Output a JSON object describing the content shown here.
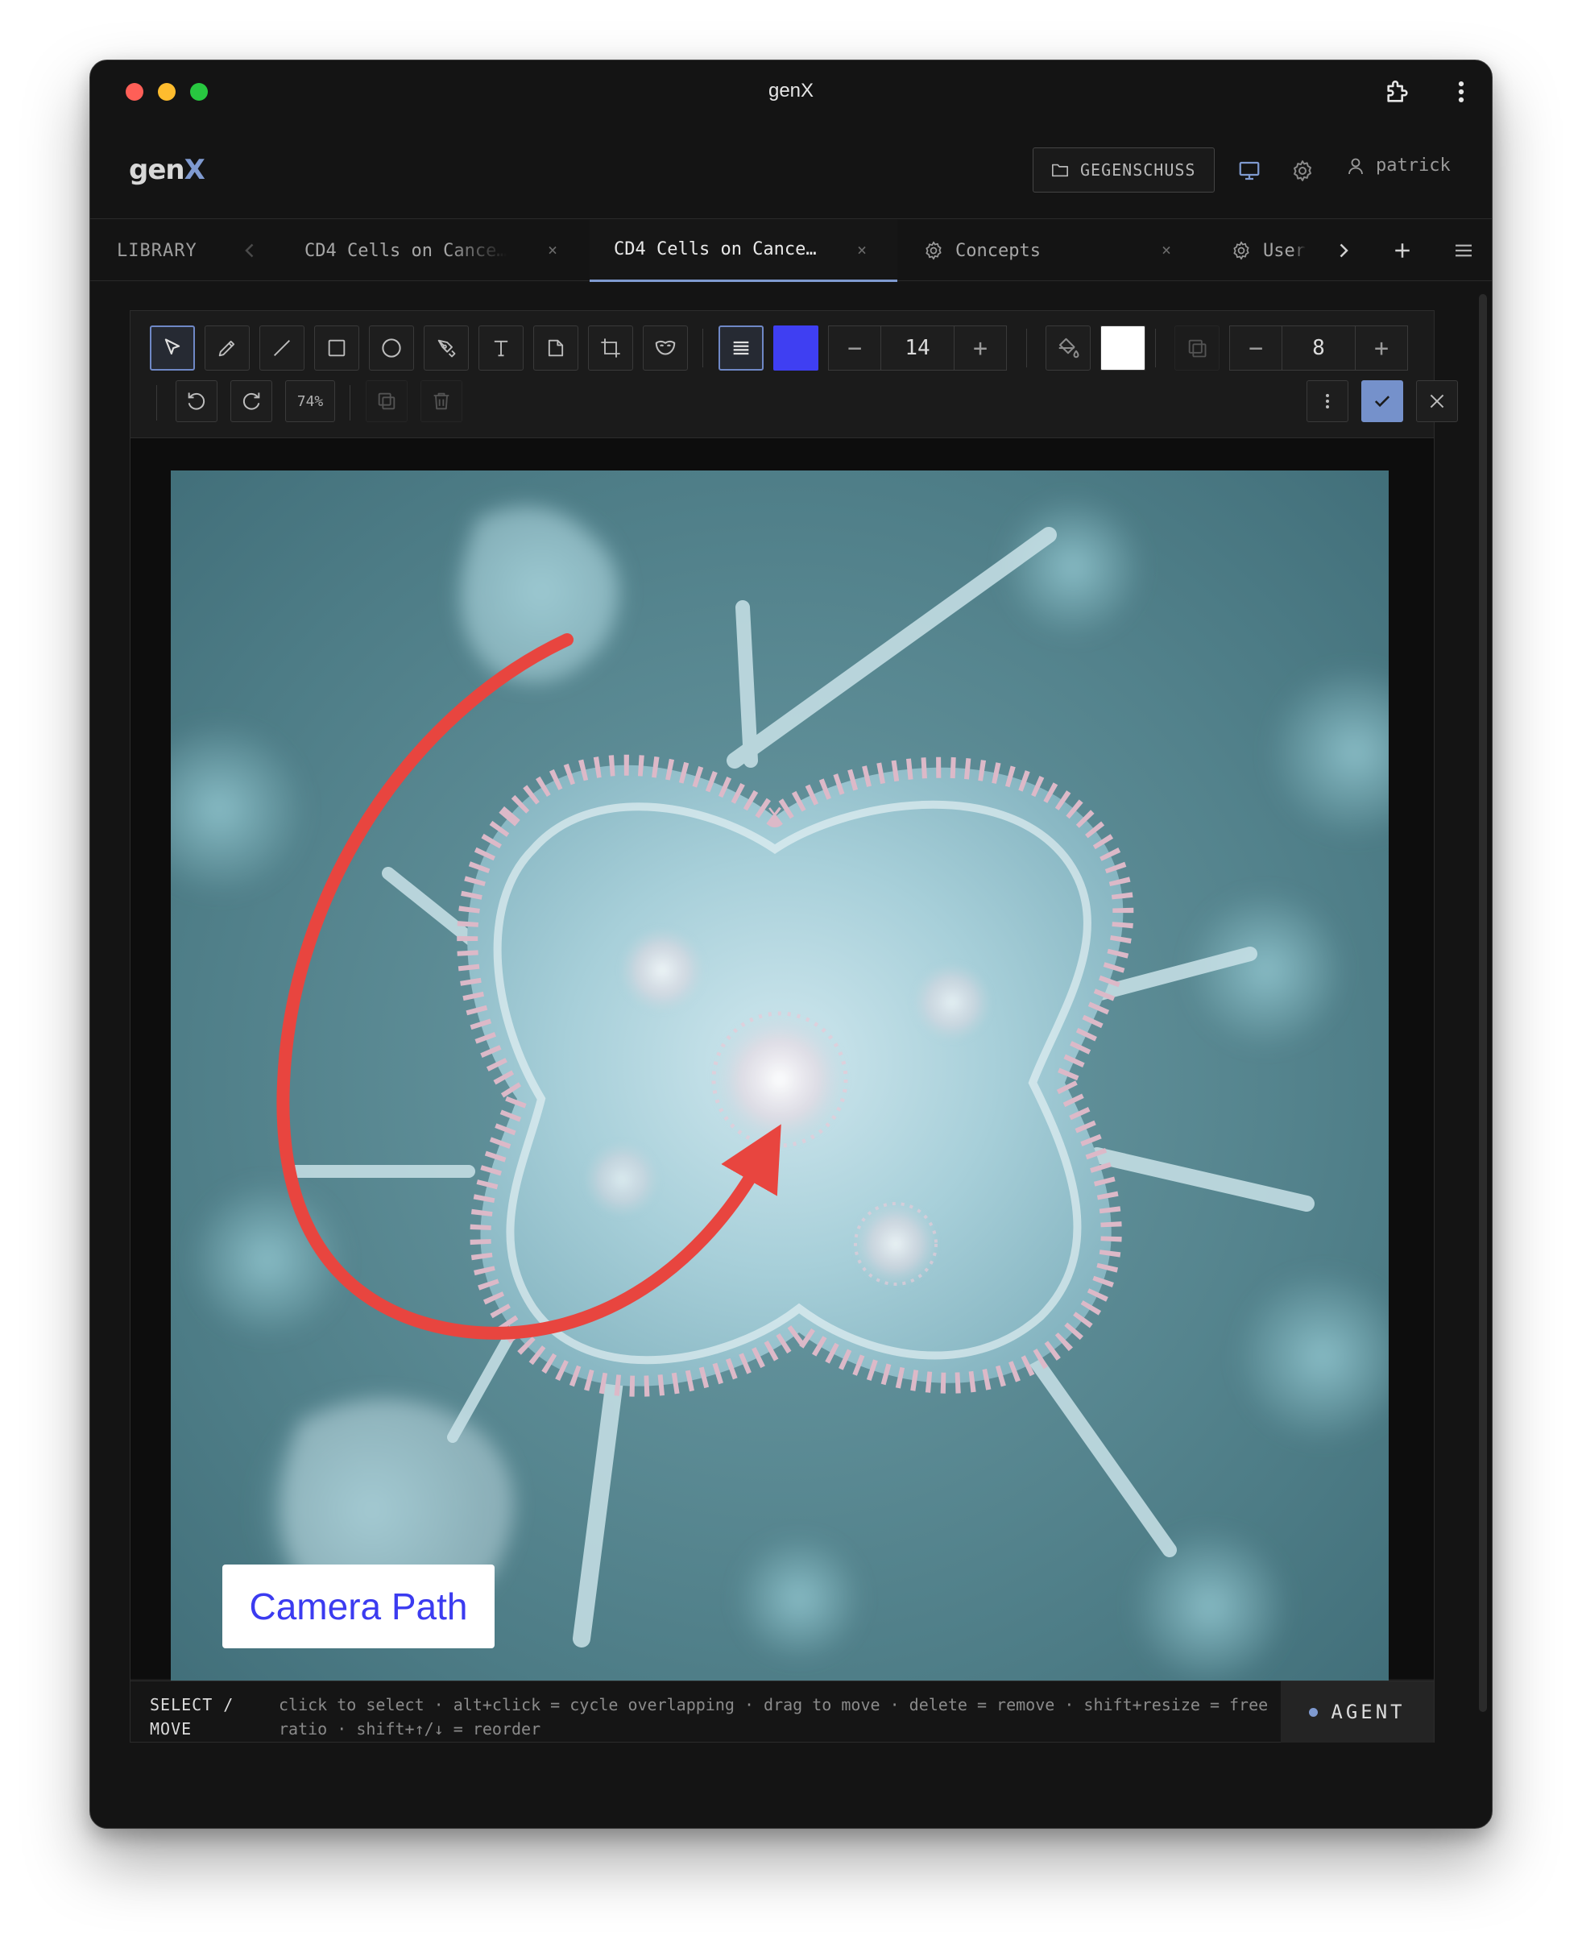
{
  "window": {
    "title": "genX"
  },
  "header": {
    "logo_text": "gen",
    "logo_accent": "X",
    "project_label": "GEGENSCHUSS",
    "username": "patrick"
  },
  "tabs": {
    "library": "LIBRARY",
    "items": [
      {
        "label": "CD4 Cells on Cance…",
        "active": false,
        "icon": null
      },
      {
        "label": "CD4 Cells on Cance…",
        "active": true,
        "icon": null
      },
      {
        "label": "Concepts",
        "active": false,
        "icon": "gear-icon"
      },
      {
        "label": "User",
        "active": false,
        "icon": "gear-icon"
      }
    ],
    "close_glyph": "×"
  },
  "toolbar": {
    "tools": [
      "select-tool",
      "pencil-tool",
      "line-tool",
      "rectangle-tool",
      "ellipse-tool",
      "pen-tool",
      "text-tool",
      "note-tool",
      "crop-tool",
      "mask-tool"
    ],
    "stroke_color": "#3f3ff2",
    "font_size": "14",
    "fill_color": "#ffffff",
    "stroke_width": "8",
    "zoom": "74%"
  },
  "canvas": {
    "annotation_label": "Camera Path",
    "arrow_color": "#e8453f",
    "label_text_color": "#3b3bf0"
  },
  "status": {
    "mode": "SELECT / MOVE",
    "hint": "click to select · alt+click = cycle overlapping · drag to move · delete = remove · shift+resize = free ratio · shift+↑/↓ = reorder",
    "agent_label": "AGENT"
  },
  "colors": {
    "accent": "#7f9ad0",
    "window_bg": "#141414"
  }
}
